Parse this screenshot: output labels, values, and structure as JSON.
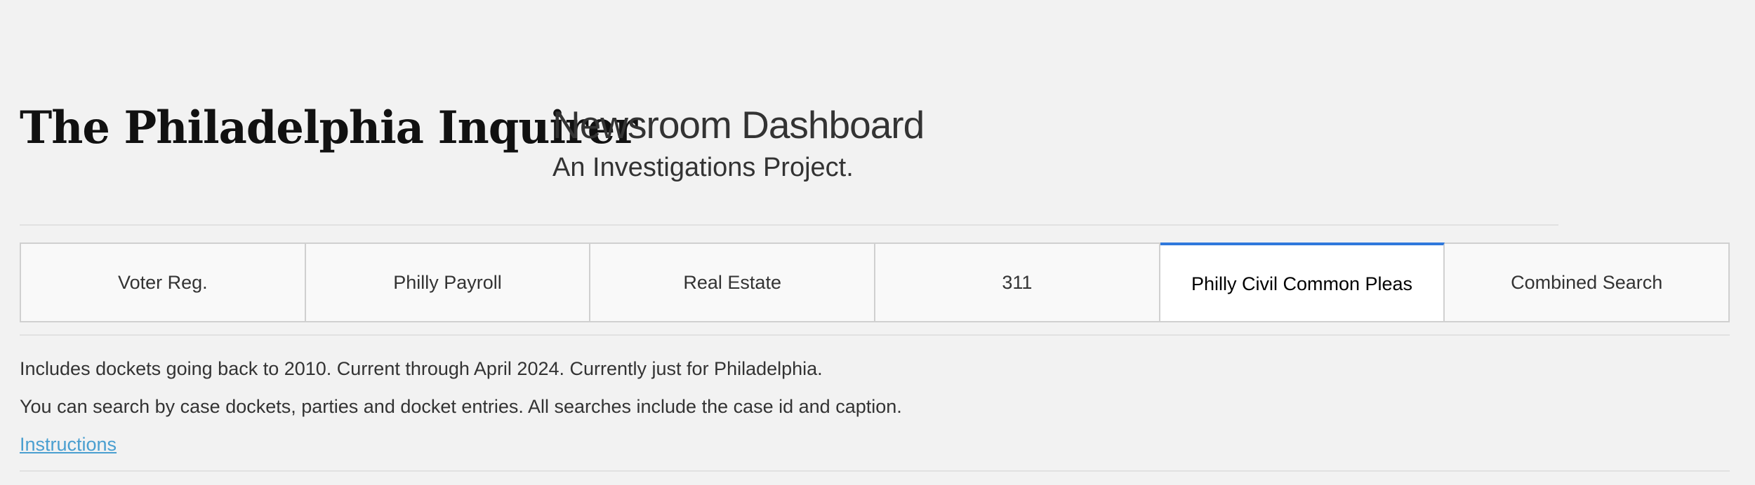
{
  "header": {
    "logo_text": "The Philadelphia Inquirer",
    "title": "Newsroom Dashboard",
    "subtitle": "An Investigations Project."
  },
  "tabs": [
    {
      "label": "Voter Reg.",
      "active": false
    },
    {
      "label": "Philly Payroll",
      "active": false
    },
    {
      "label": "Real Estate",
      "active": false
    },
    {
      "label": "311",
      "active": false
    },
    {
      "label": "Philly Civil Common Pleas",
      "active": true
    },
    {
      "label": "Combined Search",
      "active": false
    }
  ],
  "content": {
    "description_1": "Includes dockets going back to 2010. Current through April 2024. Currently just for Philadelphia.",
    "description_2": "You can search by case dockets, parties and docket entries. All searches include the case id and caption.",
    "instructions_link": "Instructions"
  },
  "colors": {
    "background": "#f2f2f2",
    "active_tab_accent": "#2f78dc",
    "link": "#4a9fd0"
  }
}
